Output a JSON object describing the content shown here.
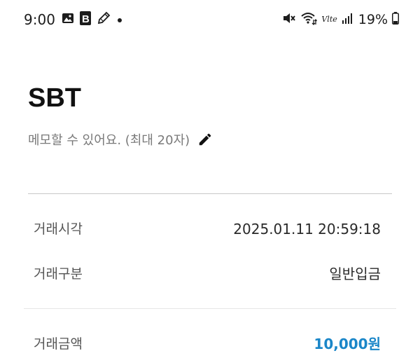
{
  "status_bar": {
    "time": "9:00",
    "battery": "19%",
    "network_label": "Vlte",
    "left_icons": [
      "gallery-icon",
      "blog-b-icon",
      "pencil-note-icon",
      "dot-icon"
    ],
    "right_icons": [
      "mute-icon",
      "wifi-icon",
      "volte-icon",
      "signal-icon",
      "battery-icon"
    ]
  },
  "header": {
    "title": "SBT",
    "memo_placeholder": "메모할 수 있어요. (최대 20자)",
    "edit_icon": "pencil-icon"
  },
  "details": {
    "time_label": "거래시각",
    "time_value": "2025.01.11 20:59:18",
    "type_label": "거래구분",
    "type_value": "일반입금",
    "amount_label": "거래금액",
    "amount_value": "10,000원"
  },
  "colors": {
    "amount": "#1a86c8",
    "divider": "#c8c8c8",
    "memo_text": "#7a7a7a"
  }
}
